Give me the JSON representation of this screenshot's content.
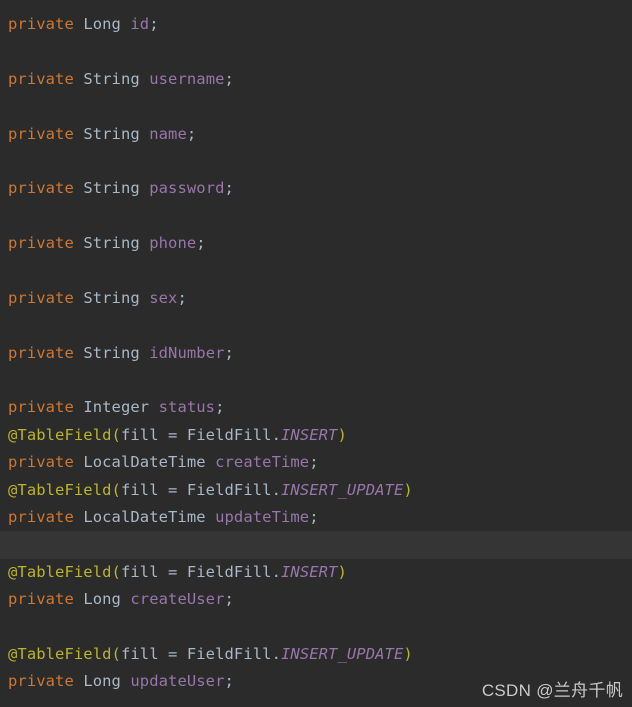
{
  "editor": {
    "background_color": "#2b2b2b",
    "highlight_row_color": "#353535",
    "language": "Java",
    "colors": {
      "keyword": "#cc7832",
      "type": "#a9b7c6",
      "field": "#9876aa",
      "annotation": "#bbb529",
      "constant": "#9876aa",
      "punctuation": "#a9b7c6",
      "watermark": "#c9c9c9"
    }
  },
  "lines": [
    {
      "index": 0,
      "kind": "code",
      "highlighted": false,
      "text": "private Long id;",
      "tokens": [
        {
          "t": "private",
          "c": "t-kw"
        },
        {
          "t": " ",
          "c": "t-plain"
        },
        {
          "t": "Long",
          "c": "t-type"
        },
        {
          "t": " ",
          "c": "t-plain"
        },
        {
          "t": "id",
          "c": "t-field"
        },
        {
          "t": ";",
          "c": "t-punc"
        }
      ]
    },
    {
      "index": 1,
      "kind": "blank",
      "highlighted": false,
      "text": "",
      "tokens": []
    },
    {
      "index": 2,
      "kind": "code",
      "highlighted": false,
      "text": "private String username;",
      "tokens": [
        {
          "t": "private",
          "c": "t-kw"
        },
        {
          "t": " ",
          "c": "t-plain"
        },
        {
          "t": "String",
          "c": "t-type"
        },
        {
          "t": " ",
          "c": "t-plain"
        },
        {
          "t": "username",
          "c": "t-field"
        },
        {
          "t": ";",
          "c": "t-punc"
        }
      ]
    },
    {
      "index": 3,
      "kind": "blank",
      "highlighted": false,
      "text": "",
      "tokens": []
    },
    {
      "index": 4,
      "kind": "code",
      "highlighted": false,
      "text": "private String name;",
      "tokens": [
        {
          "t": "private",
          "c": "t-kw"
        },
        {
          "t": " ",
          "c": "t-plain"
        },
        {
          "t": "String",
          "c": "t-type"
        },
        {
          "t": " ",
          "c": "t-plain"
        },
        {
          "t": "name",
          "c": "t-field"
        },
        {
          "t": ";",
          "c": "t-punc"
        }
      ]
    },
    {
      "index": 5,
      "kind": "blank",
      "highlighted": false,
      "text": "",
      "tokens": []
    },
    {
      "index": 6,
      "kind": "code",
      "highlighted": false,
      "text": "private String password;",
      "tokens": [
        {
          "t": "private",
          "c": "t-kw"
        },
        {
          "t": " ",
          "c": "t-plain"
        },
        {
          "t": "String",
          "c": "t-type"
        },
        {
          "t": " ",
          "c": "t-plain"
        },
        {
          "t": "password",
          "c": "t-field"
        },
        {
          "t": ";",
          "c": "t-punc"
        }
      ]
    },
    {
      "index": 7,
      "kind": "blank",
      "highlighted": false,
      "text": "",
      "tokens": []
    },
    {
      "index": 8,
      "kind": "code",
      "highlighted": false,
      "text": "private String phone;",
      "tokens": [
        {
          "t": "private",
          "c": "t-kw"
        },
        {
          "t": " ",
          "c": "t-plain"
        },
        {
          "t": "String",
          "c": "t-type"
        },
        {
          "t": " ",
          "c": "t-plain"
        },
        {
          "t": "phone",
          "c": "t-field"
        },
        {
          "t": ";",
          "c": "t-punc"
        }
      ]
    },
    {
      "index": 9,
      "kind": "blank",
      "highlighted": false,
      "text": "",
      "tokens": []
    },
    {
      "index": 10,
      "kind": "code",
      "highlighted": false,
      "text": "private String sex;",
      "tokens": [
        {
          "t": "private",
          "c": "t-kw"
        },
        {
          "t": " ",
          "c": "t-plain"
        },
        {
          "t": "String",
          "c": "t-type"
        },
        {
          "t": " ",
          "c": "t-plain"
        },
        {
          "t": "sex",
          "c": "t-field"
        },
        {
          "t": ";",
          "c": "t-punc"
        }
      ]
    },
    {
      "index": 11,
      "kind": "blank",
      "highlighted": false,
      "text": "",
      "tokens": []
    },
    {
      "index": 12,
      "kind": "code",
      "highlighted": false,
      "text": "private String idNumber;",
      "tokens": [
        {
          "t": "private",
          "c": "t-kw"
        },
        {
          "t": " ",
          "c": "t-plain"
        },
        {
          "t": "String",
          "c": "t-type"
        },
        {
          "t": " ",
          "c": "t-plain"
        },
        {
          "t": "idNumber",
          "c": "t-field"
        },
        {
          "t": ";",
          "c": "t-punc"
        }
      ]
    },
    {
      "index": 13,
      "kind": "blank",
      "highlighted": false,
      "text": "",
      "tokens": []
    },
    {
      "index": 14,
      "kind": "code",
      "highlighted": false,
      "text": "private Integer status;",
      "tokens": [
        {
          "t": "private",
          "c": "t-kw"
        },
        {
          "t": " ",
          "c": "t-plain"
        },
        {
          "t": "Integer",
          "c": "t-type"
        },
        {
          "t": " ",
          "c": "t-plain"
        },
        {
          "t": "status",
          "c": "t-field"
        },
        {
          "t": ";",
          "c": "t-punc"
        }
      ]
    },
    {
      "index": 15,
      "kind": "code",
      "highlighted": false,
      "text": "@TableField(fill = FieldFill.INSERT)",
      "tokens": [
        {
          "t": "@TableField",
          "c": "t-anno"
        },
        {
          "t": "(",
          "c": "t-anno"
        },
        {
          "t": "fill",
          "c": "t-plain"
        },
        {
          "t": " = ",
          "c": "t-plain"
        },
        {
          "t": "FieldFill",
          "c": "t-plain"
        },
        {
          "t": ".",
          "c": "t-punc"
        },
        {
          "t": "INSERT",
          "c": "t-const"
        },
        {
          "t": ")",
          "c": "t-anno"
        }
      ]
    },
    {
      "index": 16,
      "kind": "code",
      "highlighted": false,
      "text": "private LocalDateTime createTime;",
      "tokens": [
        {
          "t": "private",
          "c": "t-kw"
        },
        {
          "t": " ",
          "c": "t-plain"
        },
        {
          "t": "LocalDateTime",
          "c": "t-type"
        },
        {
          "t": " ",
          "c": "t-plain"
        },
        {
          "t": "createTime",
          "c": "t-field"
        },
        {
          "t": ";",
          "c": "t-punc"
        }
      ]
    },
    {
      "index": 17,
      "kind": "code",
      "highlighted": false,
      "text": "@TableField(fill = FieldFill.INSERT_UPDATE)",
      "tokens": [
        {
          "t": "@TableField",
          "c": "t-anno"
        },
        {
          "t": "(",
          "c": "t-anno"
        },
        {
          "t": "fill",
          "c": "t-plain"
        },
        {
          "t": " = ",
          "c": "t-plain"
        },
        {
          "t": "FieldFill",
          "c": "t-plain"
        },
        {
          "t": ".",
          "c": "t-punc"
        },
        {
          "t": "INSERT_UPDATE",
          "c": "t-const"
        },
        {
          "t": ")",
          "c": "t-anno"
        }
      ]
    },
    {
      "index": 18,
      "kind": "code",
      "highlighted": false,
      "text": "private LocalDateTime updateTime;",
      "tokens": [
        {
          "t": "private",
          "c": "t-kw"
        },
        {
          "t": " ",
          "c": "t-plain"
        },
        {
          "t": "LocalDateTime",
          "c": "t-type"
        },
        {
          "t": " ",
          "c": "t-plain"
        },
        {
          "t": "updateTime",
          "c": "t-field"
        },
        {
          "t": ";",
          "c": "t-punc"
        }
      ]
    },
    {
      "index": 19,
      "kind": "blank",
      "highlighted": true,
      "text": "",
      "tokens": []
    },
    {
      "index": 20,
      "kind": "code",
      "highlighted": false,
      "text": "@TableField(fill = FieldFill.INSERT)",
      "tokens": [
        {
          "t": "@TableField",
          "c": "t-anno"
        },
        {
          "t": "(",
          "c": "t-anno"
        },
        {
          "t": "fill",
          "c": "t-plain"
        },
        {
          "t": " = ",
          "c": "t-plain"
        },
        {
          "t": "FieldFill",
          "c": "t-plain"
        },
        {
          "t": ".",
          "c": "t-punc"
        },
        {
          "t": "INSERT",
          "c": "t-const"
        },
        {
          "t": ")",
          "c": "t-anno"
        }
      ]
    },
    {
      "index": 21,
      "kind": "code",
      "highlighted": false,
      "text": "private Long createUser;",
      "tokens": [
        {
          "t": "private",
          "c": "t-kw"
        },
        {
          "t": " ",
          "c": "t-plain"
        },
        {
          "t": "Long",
          "c": "t-type"
        },
        {
          "t": " ",
          "c": "t-plain"
        },
        {
          "t": "createUser",
          "c": "t-field"
        },
        {
          "t": ";",
          "c": "t-punc"
        }
      ]
    },
    {
      "index": 22,
      "kind": "blank",
      "highlighted": false,
      "text": "",
      "tokens": []
    },
    {
      "index": 23,
      "kind": "code",
      "highlighted": false,
      "text": "@TableField(fill = FieldFill.INSERT_UPDATE)",
      "tokens": [
        {
          "t": "@TableField",
          "c": "t-anno"
        },
        {
          "t": "(",
          "c": "t-anno"
        },
        {
          "t": "fill",
          "c": "t-plain"
        },
        {
          "t": " = ",
          "c": "t-plain"
        },
        {
          "t": "FieldFill",
          "c": "t-plain"
        },
        {
          "t": ".",
          "c": "t-punc"
        },
        {
          "t": "INSERT_UPDATE",
          "c": "t-const"
        },
        {
          "t": ")",
          "c": "t-anno"
        }
      ]
    },
    {
      "index": 24,
      "kind": "code",
      "highlighted": false,
      "text": "private Long updateUser;",
      "tokens": [
        {
          "t": "private",
          "c": "t-kw"
        },
        {
          "t": " ",
          "c": "t-plain"
        },
        {
          "t": "Long",
          "c": "t-type"
        },
        {
          "t": " ",
          "c": "t-plain"
        },
        {
          "t": "updateUser",
          "c": "t-field"
        },
        {
          "t": ";",
          "c": "t-punc"
        }
      ]
    }
  ],
  "watermark": {
    "text": "CSDN @兰舟千帆"
  }
}
